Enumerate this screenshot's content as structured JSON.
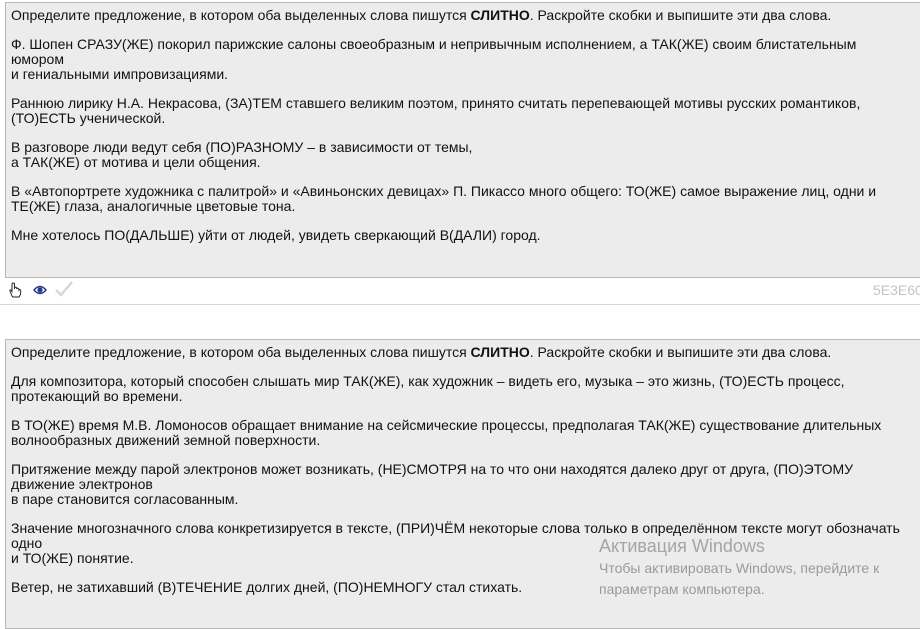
{
  "task1": {
    "instruction_pre": "Определите предложение, в котором оба выделенных слова пишутся ",
    "instruction_bold": "СЛИТНО",
    "instruction_post": ". Раскройте скобки и выпишите эти два слова.",
    "sentences": [
      {
        "line1": "Ф. Шопен СРАЗУ(ЖЕ) покорил парижские салоны своеобразным и непривычным исполнением, а ТАК(ЖЕ) своим блистательным юмором",
        "line2": "и гениальными импровизациями."
      },
      {
        "line1": "Раннюю лирику Н.А. Некрасова, (ЗА)ТЕМ ставшего великим поэтом, принято считать перепевающей мотивы русских романтиков, (ТО)ЕСТЬ ученической.",
        "line2": ""
      },
      {
        "line1": "В разговоре люди ведут себя (ПО)РАЗНОМУ – в зависимости от темы,",
        "line2": "а ТАК(ЖЕ) от мотива и цели общения."
      },
      {
        "line1": "В «Автопортрете художника с палитрой» и «Авиньонских девицах» П. Пикассо много общего: ТО(ЖЕ) самое выражение лиц, одни и ТЕ(ЖЕ) глаза, аналогичные цветовые тона.",
        "line2": ""
      },
      {
        "line1": "Мне хотелось ПО(ДАЛЬШЕ) уйти от людей, увидеть сверкающий В(ДАЛИ) город.",
        "line2": ""
      }
    ]
  },
  "toolbar": {
    "icons": [
      "hand-pointer-icon",
      "eye-icon",
      "checkmark-icon"
    ],
    "code": "5E3E60"
  },
  "task2": {
    "instruction_pre": "Определите предложение, в котором оба выделенных слова пишутся ",
    "instruction_bold": "СЛИТНО",
    "instruction_post": ". Раскройте скобки и выпишите эти два слова.",
    "sentences": [
      {
        "line1": "Для композитора, который способен слышать мир ТАК(ЖЕ), как художник – видеть его, музыка – это жизнь, (ТО)ЕСТЬ процесс, протекающий во времени.",
        "line2": ""
      },
      {
        "line1": "В ТО(ЖЕ) время М.В. Ломоносов обращает внимание на сейсмические процессы, предполагая ТАК(ЖЕ) существование длительных волнообразных движений земной поверхности.",
        "line2": ""
      },
      {
        "line1": "Притяжение между парой электронов может возникать, (НЕ)СМОТРЯ на то что они находятся далеко друг от друга, (ПО)ЭТОМУ движение электронов",
        "line2": "в паре становится согласованным."
      },
      {
        "line1": "Значение многозначного слова конкретизируется в тексте, (ПРИ)ЧЁМ некоторые слова только в определённом тексте могут обозначать одно",
        "line2": "и ТО(ЖЕ) понятие."
      },
      {
        "line1": "Ветер, не затихавший (В)ТЕЧЕНИЕ долгих дней, (ПО)НЕМНОГУ стал стихать.",
        "line2": ""
      }
    ]
  },
  "watermark": {
    "title": "Активация Windows",
    "line1": "Чтобы активировать Windows, перейдите к",
    "line2": "параметрам компьютера."
  }
}
